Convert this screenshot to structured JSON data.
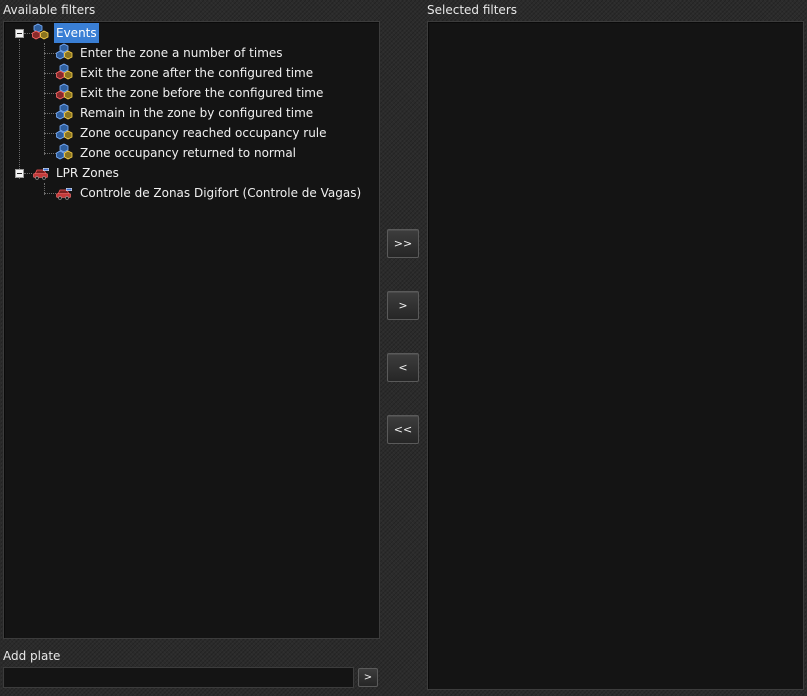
{
  "available_filters": {
    "label": "Available filters",
    "tree": [
      {
        "label": "Events",
        "icon": "cubes-icon",
        "selected": true,
        "expanded": true,
        "children": [
          {
            "label": "Enter the zone a number of times",
            "icon": "cubes-icon"
          },
          {
            "label": "Exit the zone after the configured time",
            "icon": "cubes-icon"
          },
          {
            "label": "Exit the zone before the configured time",
            "icon": "cubes-icon"
          },
          {
            "label": "Remain in the zone by configured time",
            "icon": "cubes-icon"
          },
          {
            "label": "Zone occupancy reached occupancy rule",
            "icon": "cubes-icon"
          },
          {
            "label": "Zone occupancy returned to normal",
            "icon": "cubes-icon"
          }
        ]
      },
      {
        "label": "LPR Zones",
        "icon": "car-icon",
        "selected": false,
        "expanded": true,
        "children": [
          {
            "label": "Controle de Zonas Digifort (Controle de Vagas)",
            "icon": "car-icon"
          }
        ]
      }
    ]
  },
  "selected_filters": {
    "label": "Selected filters",
    "items": []
  },
  "transfer_buttons": {
    "add_all": ">>",
    "add_one": ">",
    "remove_one": "<",
    "remove_all": "<<"
  },
  "add_plate": {
    "label": "Add plate",
    "value": "",
    "placeholder": "",
    "button": ">"
  },
  "colors": {
    "selection": "#3a7fd5",
    "panel_bg": "#141414",
    "window_bg": "#2b2b2b"
  }
}
